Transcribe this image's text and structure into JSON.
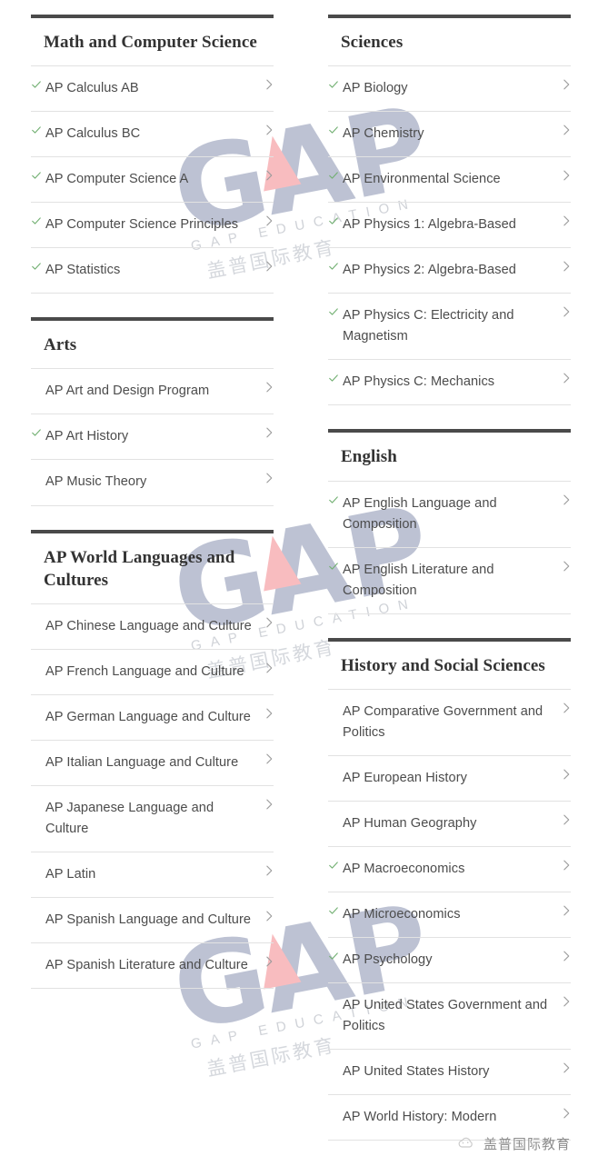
{
  "columns": [
    {
      "id": "left",
      "sections": [
        {
          "title": "Math and Computer Science",
          "courses": [
            {
              "label": "AP Calculus AB",
              "checked": true
            },
            {
              "label": "AP Calculus BC",
              "checked": true
            },
            {
              "label": "AP Computer Science A",
              "checked": true
            },
            {
              "label": "AP Computer Science Principles",
              "checked": true
            },
            {
              "label": "AP Statistics",
              "checked": true
            }
          ]
        },
        {
          "title": "Arts",
          "courses": [
            {
              "label": "AP Art and Design Program",
              "checked": false
            },
            {
              "label": "AP Art History",
              "checked": true
            },
            {
              "label": "AP Music Theory",
              "checked": false
            }
          ]
        },
        {
          "title": "AP World Languages and Cultures",
          "courses": [
            {
              "label": "AP Chinese Language and Culture",
              "checked": false
            },
            {
              "label": "AP French Language and Culture",
              "checked": false
            },
            {
              "label": "AP German Language and Culture",
              "checked": false
            },
            {
              "label": "AP Italian Language and Culture",
              "checked": false
            },
            {
              "label": "AP Japanese Language and Culture",
              "checked": false
            },
            {
              "label": "AP Latin",
              "checked": false
            },
            {
              "label": "AP Spanish Language and Culture",
              "checked": false
            },
            {
              "label": "AP Spanish Literature and Culture",
              "checked": false
            }
          ]
        }
      ]
    },
    {
      "id": "right",
      "sections": [
        {
          "title": "Sciences",
          "courses": [
            {
              "label": "AP Biology",
              "checked": true
            },
            {
              "label": "AP Chemistry",
              "checked": true
            },
            {
              "label": "AP Environmental Science",
              "checked": true
            },
            {
              "label": "AP Physics 1: Algebra-Based",
              "checked": true
            },
            {
              "label": "AP Physics 2: Algebra-Based",
              "checked": true
            },
            {
              "label": "AP Physics C: Electricity and Magnetism",
              "checked": true
            },
            {
              "label": "AP Physics C: Mechanics",
              "checked": true
            }
          ]
        },
        {
          "title": "English",
          "courses": [
            {
              "label": "AP English Language and Composition",
              "checked": true
            },
            {
              "label": "AP English Literature and Composition",
              "checked": true
            }
          ]
        },
        {
          "title": "History and Social Sciences",
          "courses": [
            {
              "label": "AP Comparative Government and Politics",
              "checked": false
            },
            {
              "label": "AP European History",
              "checked": false
            },
            {
              "label": "AP Human Geography",
              "checked": false
            },
            {
              "label": "AP Macroeconomics",
              "checked": true
            },
            {
              "label": "AP Microeconomics",
              "checked": true
            },
            {
              "label": "AP Psychology",
              "checked": true
            },
            {
              "label": "AP United States Government and Politics",
              "checked": false
            },
            {
              "label": "AP United States History",
              "checked": false
            },
            {
              "label": "AP World History: Modern",
              "checked": false
            }
          ]
        }
      ]
    }
  ],
  "watermarks": [
    {
      "logo": "GAP",
      "subtitle": "GAP EDUCATION",
      "chinese": "盖普国际教育"
    },
    {
      "logo": "GAP",
      "subtitle": "GAP EDUCATION",
      "chinese": "盖普国际教育"
    },
    {
      "logo": "GAP",
      "subtitle": "GAP EDUCATION",
      "chinese": "盖普国际教育"
    }
  ],
  "footer": {
    "brand_text": "盖普国际教育",
    "brand_icon": "cloud-logo-icon"
  },
  "colors": {
    "section_rule": "#4a4a4a",
    "section_title": "#333333",
    "course_text": "#4c4c4c",
    "row_divider": "#e2e2e2",
    "check_green": "#72b072",
    "chevron_gray": "#9b9b9b",
    "watermark_blue": "#8892b0",
    "watermark_pink": "#f4878c"
  }
}
